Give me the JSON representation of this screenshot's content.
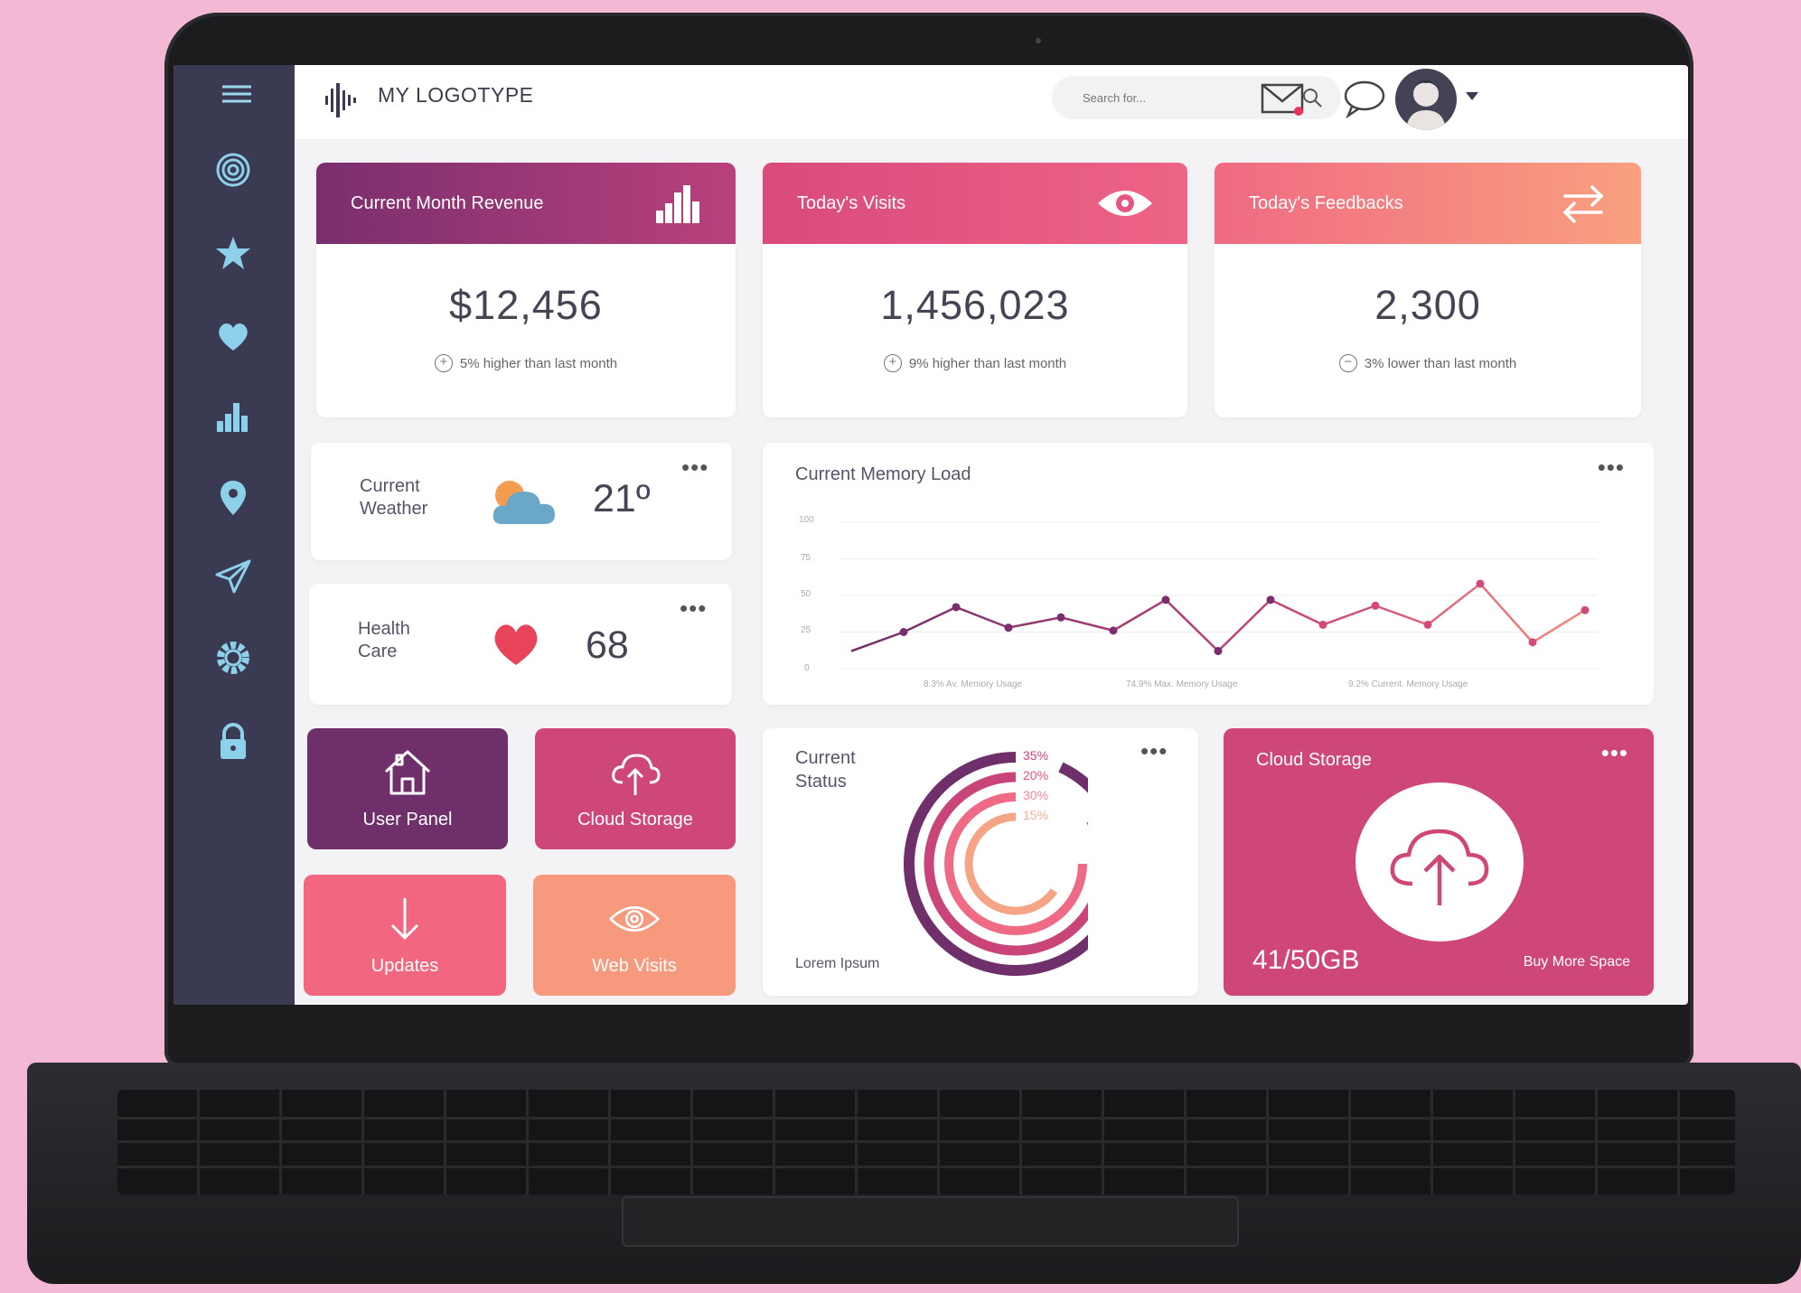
{
  "header": {
    "logo_text": "MY LOGOTYPE",
    "search_placeholder": "Search for..."
  },
  "sidebar": {
    "icons": [
      "menu-icon",
      "target-icon",
      "star-icon",
      "heart-icon",
      "bar-chart-icon",
      "location-pin-icon",
      "send-icon",
      "gear-icon",
      "lock-icon"
    ]
  },
  "stats": [
    {
      "title": "Current Month Revenue",
      "value": "$12,456",
      "note": "5% higher than last month",
      "trend": "+",
      "icon": "bar-chart-icon",
      "color_from": "#7a2e6e",
      "color_to": "#b9417c"
    },
    {
      "title": "Today's Visits",
      "value": "1,456,023",
      "note": "9% higher than last month",
      "trend": "+",
      "icon": "eye-icon",
      "color_from": "#d94a7d",
      "color_to": "#ee6485"
    },
    {
      "title": "Today's Feedbacks",
      "value": "2,300",
      "note": "3% lower than last month",
      "trend": "−",
      "icon": "swap-arrows-icon",
      "color_from": "#f06a82",
      "color_to": "#f9a07f"
    }
  ],
  "weather": {
    "label": "Current Weather",
    "value": "21º"
  },
  "health": {
    "label": "Health Care",
    "value": "68"
  },
  "tiles": [
    {
      "label": "User Panel",
      "icon": "home-icon",
      "color": "#6e2f6b"
    },
    {
      "label": "Cloud Storage",
      "icon": "cloud-upload-icon",
      "color": "#cf4679"
    },
    {
      "label": "Updates",
      "icon": "download-arrow-icon",
      "color": "#f2667f"
    },
    {
      "label": "Web Visits",
      "icon": "eye-icon",
      "color": "#f6997c"
    }
  ],
  "memory": {
    "title": "Current Memory Load",
    "legend": [
      "8.3% Av. Memory Usage",
      "74.9% Max. Memory Usage",
      "9.2% Current. Memory Usage"
    ]
  },
  "chart_data": {
    "type": "line",
    "title": "Current Memory Load",
    "ylim": [
      0,
      100
    ],
    "yticks": [
      "100",
      "75",
      "50",
      "25",
      "0"
    ],
    "series": [
      {
        "values": [
          12,
          25,
          42,
          28,
          35,
          26,
          47,
          12,
          47,
          30,
          43,
          30,
          58,
          18,
          40
        ]
      }
    ],
    "grid": true
  },
  "status": {
    "title": "Current Status",
    "footer": "Lorem Ipsum",
    "rings": [
      {
        "pct": "35%",
        "color": "#6e2f6b"
      },
      {
        "pct": "20%",
        "color": "#c94579"
      },
      {
        "pct": "30%",
        "color": "#ef6a85"
      },
      {
        "pct": "15%",
        "color": "#f5a585"
      }
    ]
  },
  "cloud": {
    "title": "Cloud Storage",
    "usage": "41/50GB",
    "action": "Buy More Space",
    "color": "#cf4679"
  }
}
